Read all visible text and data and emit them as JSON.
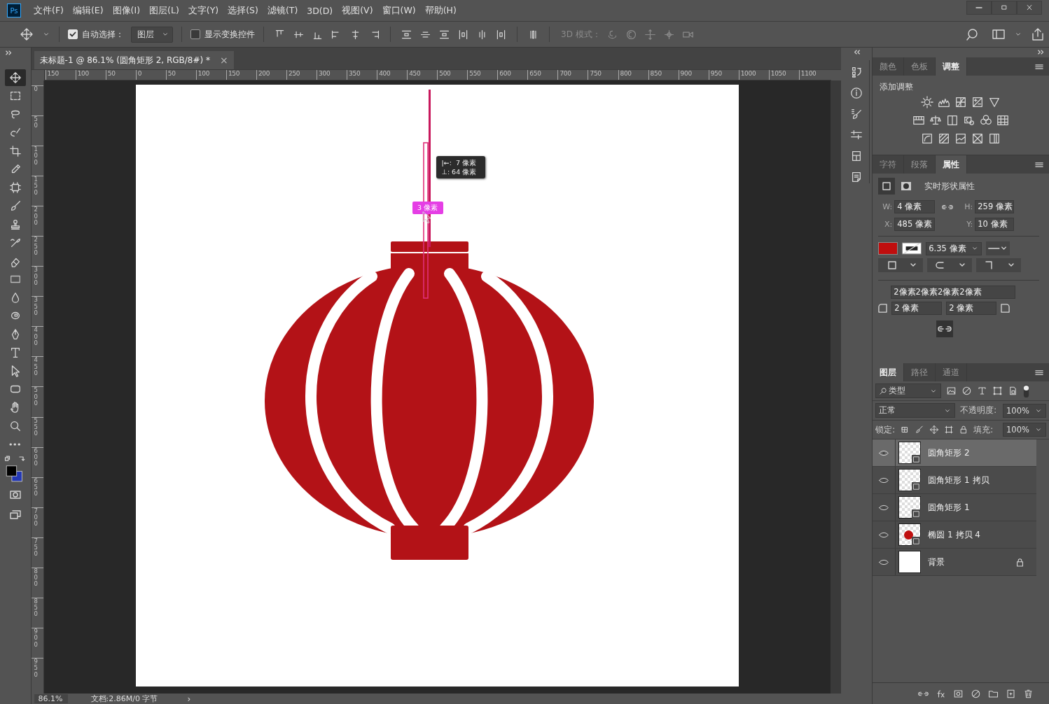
{
  "app": {
    "logo": "Ps"
  },
  "menu": [
    "文件(F)",
    "编辑(E)",
    "图像(I)",
    "图层(L)",
    "文字(Y)",
    "选择(S)",
    "滤镜(T)",
    "3D(D)",
    "视图(V)",
    "窗口(W)",
    "帮助(H)"
  ],
  "options": {
    "auto_select": {
      "label": "自动选择：",
      "checked": true
    },
    "auto_select_target": "图层",
    "show_transform": {
      "label": "显示变换控件",
      "checked": false
    },
    "mode_3d": "3D 模式："
  },
  "document_tab": {
    "title": "未标题-1 @ 86.1% (圆角矩形 2, RGB/8#) *",
    "close": "×"
  },
  "ruler_h": [
    "150",
    "100",
    "50",
    "0",
    "50",
    "100",
    "150",
    "200",
    "250",
    "300",
    "350",
    "400",
    "450",
    "500",
    "550",
    "600",
    "650",
    "700",
    "750",
    "800",
    "850",
    "900",
    "950",
    "1000",
    "1050",
    "1100"
  ],
  "ruler_v": [
    "0",
    "50",
    "100",
    "150",
    "200",
    "250",
    "300",
    "350",
    "400",
    "450",
    "500",
    "550",
    "600",
    "650",
    "700",
    "750",
    "800",
    "850",
    "900",
    "950"
  ],
  "tools": [
    {
      "kind": "move",
      "selected": true
    },
    {
      "kind": "marquee",
      "selected": false
    },
    {
      "kind": "lasso",
      "selected": false
    },
    {
      "kind": "quick",
      "selected": false
    },
    {
      "kind": "crop",
      "selected": false
    },
    {
      "kind": "eyedropper",
      "selected": false
    },
    {
      "kind": "frame",
      "selected": false
    },
    {
      "kind": "brush",
      "selected": false
    },
    {
      "kind": "stamp",
      "selected": false
    },
    {
      "kind": "history",
      "selected": false
    },
    {
      "kind": "eraser",
      "selected": false
    },
    {
      "kind": "gradient",
      "selected": false
    },
    {
      "kind": "blur",
      "selected": false
    },
    {
      "kind": "dodge",
      "selected": false
    },
    {
      "kind": "pen",
      "selected": false
    },
    {
      "kind": "type",
      "selected": false
    },
    {
      "kind": "select",
      "selected": false
    },
    {
      "kind": "shape",
      "selected": false
    },
    {
      "kind": "hand",
      "selected": false
    },
    {
      "kind": "zoom",
      "selected": false
    },
    {
      "kind": "more",
      "selected": false
    }
  ],
  "canvas": {
    "measure_tip": [
      "|←:  7 像素",
      "⊥: 64 像素"
    ],
    "spacing_label": "3 像素"
  },
  "status_bar": {
    "zoom": "86.1%",
    "doc_info": "文档:2.86M/0 字节",
    "arrow": "›"
  },
  "adjust_panel": {
    "tabs": [
      {
        "label": "颜色",
        "selected": false
      },
      {
        "label": "色板",
        "selected": false
      },
      {
        "label": "调整",
        "selected": true
      }
    ],
    "heading": "添加调整"
  },
  "properties_panel": {
    "tabs": [
      {
        "label": "字符",
        "selected": false
      },
      {
        "label": "段落",
        "selected": false
      },
      {
        "label": "属性",
        "selected": true
      }
    ],
    "heading": "实时形状属性",
    "fields": [
      {
        "label": "W:",
        "value": "4 像素"
      },
      {
        "label": "H:",
        "value": "259 像素"
      },
      {
        "label": "X:",
        "value": "485 像素"
      },
      {
        "label": "Y:",
        "value": "10 像素"
      }
    ],
    "stroke_width": "6.35 像素",
    "corners": "2像素2像素2像素2像素",
    "corner_left": "2 像素",
    "corner_right": "2 像素"
  },
  "layers_panel": {
    "tabs": [
      {
        "label": "图层",
        "selected": true
      },
      {
        "label": "路径",
        "selected": false
      },
      {
        "label": "通道",
        "selected": false
      }
    ],
    "filter": "类型",
    "blend": "正常",
    "opacity_label": "不透明度:",
    "opacity": "100%",
    "lock_label": "锁定:",
    "fill_label": "填充:",
    "fill": "100%",
    "layers": [
      {
        "name": "圆角矩形 2",
        "visible": true,
        "selected": true,
        "locked": false,
        "kind": "shape"
      },
      {
        "name": "圆角矩形 1 拷贝",
        "visible": true,
        "selected": false,
        "locked": false,
        "kind": "shape"
      },
      {
        "name": "圆角矩形 1",
        "visible": true,
        "selected": false,
        "locked": false,
        "kind": "shape"
      },
      {
        "name": "椭圆 1 拷贝 4",
        "visible": true,
        "selected": false,
        "locked": false,
        "kind": "ellipse"
      },
      {
        "name": "背景",
        "visible": true,
        "selected": false,
        "locked": true,
        "kind": "white"
      }
    ]
  }
}
